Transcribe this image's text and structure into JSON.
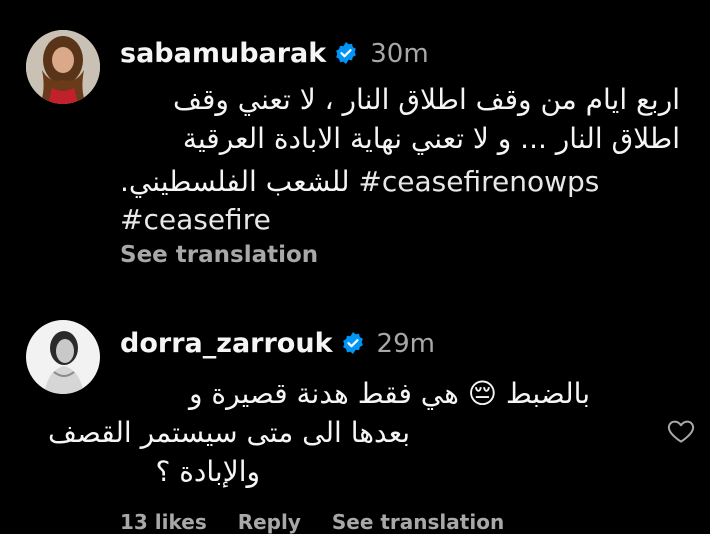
{
  "comments": [
    {
      "username": "sabamubarak",
      "time": "30m",
      "lines": [
        "اربع ايام من وقف اطلاق النار ، لا تعني وقف",
        "اطلاق النار ... و لا تعني نهاية الابادة العرقية"
      ],
      "line3_hashtag": "#ceasefirenowps",
      "line3_text": "للشعب الفلسطيني.",
      "line4_hashtag": "#ceasefire",
      "see_translation": "See translation"
    },
    {
      "username": "dorra_zarrouk",
      "time": "29m",
      "lines": [
        "بالضبط 😔 هي فقط هدنة قصيرة و",
        "بعدها الى متى سيستمر القصف",
        "والإبادة ؟"
      ]
    }
  ],
  "footer": {
    "likes": "13 likes",
    "reply": "Reply",
    "see_translation": "See translation"
  },
  "icons": {
    "verified": "verified-badge-icon",
    "like": "heart-outline-icon"
  },
  "colors": {
    "background": "#000000",
    "verified": "#0095f6",
    "secondary_text": "#a8a8a8"
  }
}
